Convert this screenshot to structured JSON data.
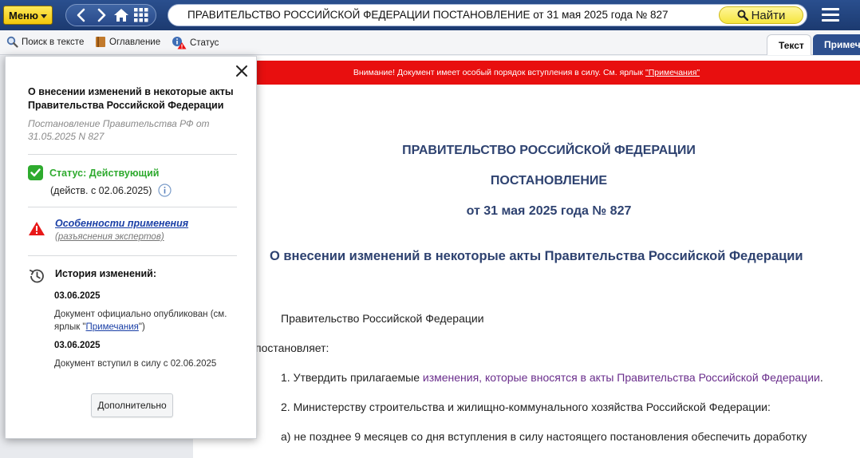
{
  "topbar": {
    "menu_label": "Меню",
    "search_query": "ПРАВИТЕЛЬСТВО РОССИЙСКОЙ ФЕДЕРАЦИИ  ПОСТАНОВЛЕНИЕ  от 31 мая 2025 года № 827",
    "find_label": "Найти"
  },
  "toolbar": {
    "search_in_text": "Поиск в тексте",
    "contents": "Оглавление",
    "status": "Статус",
    "tab_text": "Текст",
    "tab_notes": "Примеча"
  },
  "warning": {
    "text": "Внимание! Документ имеет особый порядок вступления в силу. См. ярлык",
    "link": "\"Примечания\""
  },
  "document": {
    "heading1": "ПРАВИТЕЛЬСТВО РОССИЙСКОЙ ФЕДЕРАЦИИ",
    "heading2": "ПОСТАНОВЛЕНИЕ",
    "heading3": "от 31 мая 2025 года № 827",
    "title": "О внесении изменений в некоторые акты Правительства Российской Федерации",
    "p1": "Правительство Российской Федерации",
    "p2": "постановляет:",
    "p3_prefix": "1. Утвердить прилагаемые ",
    "p3_link": "изменения, которые вносятся в акты Правительства Российской Федерации",
    "p3_suffix": ".",
    "p4": "2. Министерству строительства и жилищно-коммунального хозяйства Российской Федерации:",
    "p5": "а) не позднее 9 месяцев со дня вступления в силу настоящего постановления обеспечить доработку"
  },
  "popup": {
    "title": "О внесении изменений в некоторые акты Правительства Российской Федерации",
    "subtitle": "Постановление Правительства РФ от 31.05.2025 N 827",
    "status_label": "Статус: Действующий",
    "status_since": "(действ. с 02.06.2025)",
    "feature_link": "Особенности применения",
    "feature_sub": "(разъяснения экспертов)",
    "history_title": "История изменений:",
    "history": [
      {
        "date": "03.06.2025",
        "text_prefix": "Документ официально опубликован (см. ярлык \"",
        "text_link": "Примечания",
        "text_suffix": "\")"
      },
      {
        "date": "03.06.2025",
        "text": "Документ вступил в силу с 02.06.2025"
      }
    ],
    "more_button": "Дополнительно"
  },
  "colors": {
    "topbar": "#1c3a70",
    "warning": "#e80f0f",
    "status_ok": "#2eab2e",
    "heading": "#2e4270",
    "link": "#1a3fa6"
  },
  "icons": [
    "chevron-left-icon",
    "chevron-right-icon",
    "home-icon",
    "grid-icon",
    "search-icon",
    "hamburger-icon",
    "magnifier-icon",
    "book-icon",
    "info-warning-icon",
    "close-icon",
    "checkmark-icon",
    "info-icon",
    "warning-triangle-icon",
    "history-icon"
  ]
}
